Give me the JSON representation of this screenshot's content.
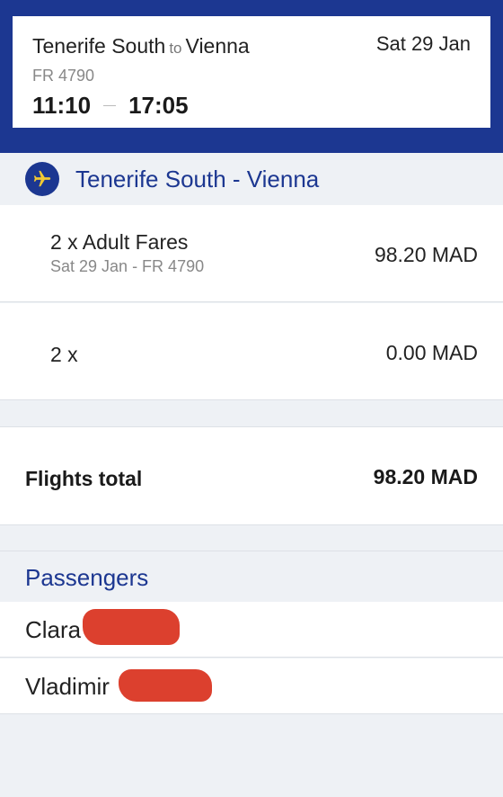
{
  "flight_card": {
    "origin": "Tenerife South",
    "to_word": "to",
    "destination": "Vienna",
    "date": "Sat 29 Jan",
    "flight_number": "FR 4790",
    "depart_time": "11:10",
    "arrive_time": "17:05"
  },
  "route_section": {
    "icon": "airplane-icon",
    "title": "Tenerife South - Vienna"
  },
  "fares": {
    "label": "2 x Adult Fares",
    "sub": "Sat 29 Jan - FR 4790",
    "price": "98.20 MAD"
  },
  "extra": {
    "label": "2 x",
    "price": "0.00 MAD"
  },
  "total": {
    "label": "Flights total",
    "price": "98.20 MAD"
  },
  "passengers": {
    "title": "Passengers",
    "items": [
      {
        "first_name": "Clara"
      },
      {
        "first_name": "Vladimir"
      }
    ]
  },
  "colors": {
    "brand_blue": "#1c3791",
    "accent_yellow": "#f1c933",
    "redaction_red": "#d9301c"
  }
}
